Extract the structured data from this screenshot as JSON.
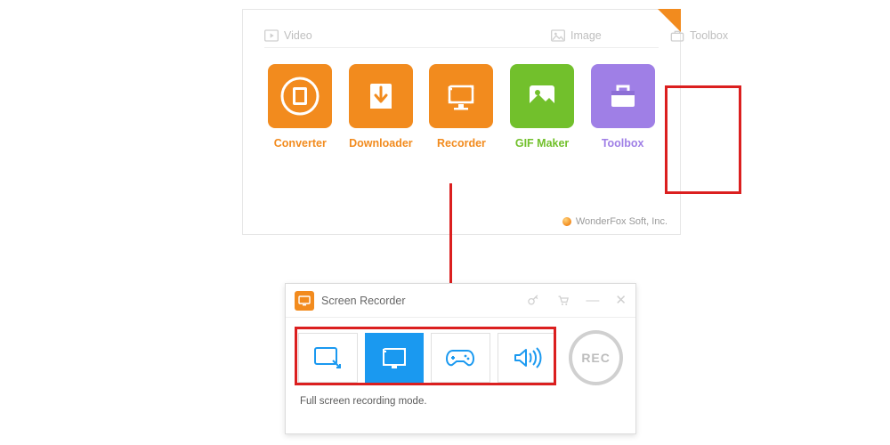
{
  "mainWindow": {
    "categories": {
      "video": "Video",
      "image": "Image",
      "toolbox": "Toolbox"
    },
    "tiles": [
      {
        "label": "Converter",
        "colorClass": "c-orange"
      },
      {
        "label": "Downloader",
        "colorClass": "c-orange"
      },
      {
        "label": "Recorder",
        "colorClass": "c-orange"
      },
      {
        "label": "GIF Maker",
        "colorClass": "c-green"
      },
      {
        "label": "Toolbox",
        "colorClass": "c-purple"
      }
    ],
    "brand": "WonderFox Soft, Inc."
  },
  "recorderWindow": {
    "title": "Screen Recorder",
    "modes": [
      {
        "name": "region-mode",
        "active": false
      },
      {
        "name": "fullscreen-mode",
        "active": true
      },
      {
        "name": "game-mode",
        "active": false
      },
      {
        "name": "audio-mode",
        "active": false
      }
    ],
    "recLabel": "REC",
    "status": "Full screen recording mode."
  }
}
